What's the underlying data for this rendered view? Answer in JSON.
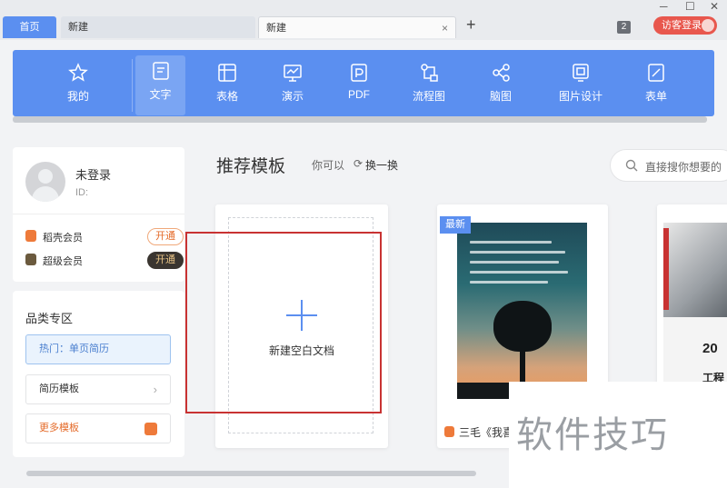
{
  "tabs": [
    {
      "label": "首页"
    },
    {
      "label": "新建"
    },
    {
      "label": "新建",
      "close": "×"
    }
  ],
  "titlebar": {
    "add_tab": "+",
    "window_count": "2",
    "guest_login": "访客登录",
    "min": "─",
    "max": "☐",
    "close": "✕"
  },
  "toolbar": {
    "items": [
      {
        "label": "我的",
        "icon": "star-icon"
      },
      {
        "label": "文字",
        "icon": "document-icon",
        "active": true
      },
      {
        "label": "表格",
        "icon": "table-icon"
      },
      {
        "label": "演示",
        "icon": "presentation-icon"
      },
      {
        "label": "PDF",
        "icon": "pdf-icon"
      },
      {
        "label": "流程图",
        "icon": "flowchart-icon"
      },
      {
        "label": "脑图",
        "icon": "mindmap-icon"
      },
      {
        "label": "图片设计",
        "icon": "image-design-icon"
      },
      {
        "label": "表单",
        "icon": "form-icon"
      }
    ]
  },
  "user": {
    "name": "未登录",
    "id_label": "ID:",
    "vip1": {
      "label": "稻壳会员",
      "button": "开通"
    },
    "vip2": {
      "label": "超级会员",
      "button": "开通"
    }
  },
  "categories": {
    "title": "品类专区",
    "hot": "热门：单页简历",
    "resume": "简历模板",
    "more": "更多模板"
  },
  "main": {
    "section_title": "推荐模板",
    "hint": "你可以",
    "refresh": "换一换",
    "search_placeholder": "直接搜你想要的",
    "blank_label": "新建空白文档",
    "badge_new": "最新",
    "template1_caption": "三毛《我喜",
    "template2_text1": "20",
    "template2_text2": "工程"
  },
  "watermark": "软件技巧",
  "colors": {
    "accent": "#5b8ff0",
    "highlight_box": "#c83232",
    "guest_button": "#e8574d"
  }
}
